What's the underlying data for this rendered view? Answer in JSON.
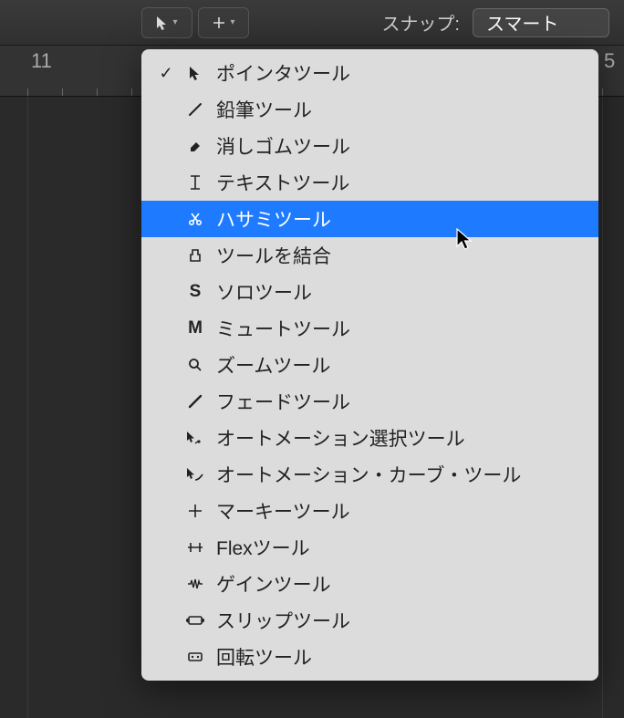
{
  "toolbar": {
    "snap_label": "スナップ:",
    "snap_value": "スマート"
  },
  "ruler": {
    "marker1": "11",
    "marker2": "5"
  },
  "menu": {
    "items": [
      {
        "label": "ポインタツール",
        "icon": "pointer",
        "checked": true
      },
      {
        "label": "鉛筆ツール",
        "icon": "pencil"
      },
      {
        "label": "消しゴムツール",
        "icon": "eraser"
      },
      {
        "label": "テキストツール",
        "icon": "text"
      },
      {
        "label": "ハサミツール",
        "icon": "scissors",
        "selected": true
      },
      {
        "label": "ツールを結合",
        "icon": "glue"
      },
      {
        "label": "ソロツール",
        "icon": "solo"
      },
      {
        "label": "ミュートツール",
        "icon": "mute"
      },
      {
        "label": "ズームツール",
        "icon": "zoom"
      },
      {
        "label": "フェードツール",
        "icon": "fade"
      },
      {
        "label": "オートメーション選択ツール",
        "icon": "auto-select"
      },
      {
        "label": "オートメーション・カーブ・ツール",
        "icon": "auto-curve"
      },
      {
        "label": "マーキーツール",
        "icon": "marquee"
      },
      {
        "label": "Flexツール",
        "icon": "flex"
      },
      {
        "label": "ゲインツール",
        "icon": "gain"
      },
      {
        "label": "スリップツール",
        "icon": "slip"
      },
      {
        "label": "回転ツール",
        "icon": "rotate"
      }
    ]
  }
}
